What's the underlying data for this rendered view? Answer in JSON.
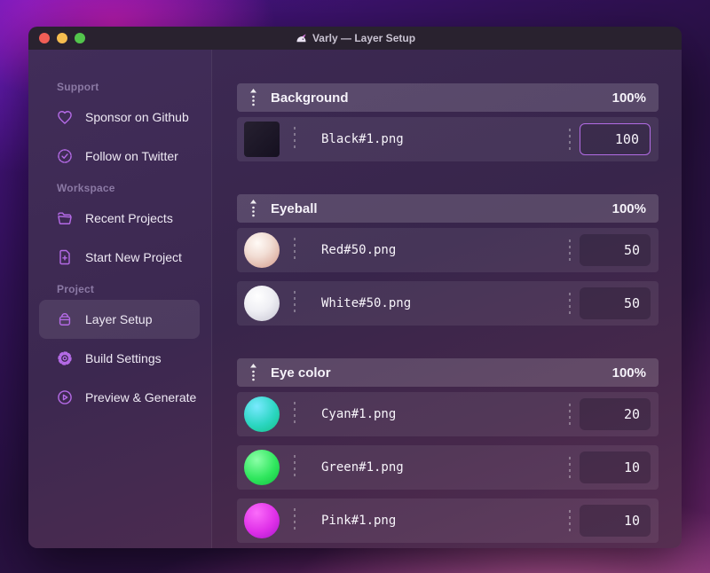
{
  "window": {
    "title": "Varly — Layer Setup",
    "app_icon": "unicorn",
    "traffic_lights": [
      "close",
      "minimize",
      "zoom"
    ]
  },
  "sidebar": {
    "sections": [
      {
        "label": "Support",
        "items": [
          {
            "label": "Sponsor on Github",
            "icon": "heart-icon"
          },
          {
            "label": "Follow on Twitter",
            "icon": "verified-check-icon"
          }
        ]
      },
      {
        "label": "Workspace",
        "items": [
          {
            "label": "Recent Projects",
            "icon": "folder-icon"
          },
          {
            "label": "Start New Project",
            "icon": "file-plus-icon"
          }
        ]
      },
      {
        "label": "Project",
        "items": [
          {
            "label": "Layer Setup",
            "icon": "layers-box-icon",
            "selected": true
          },
          {
            "label": "Build Settings",
            "icon": "gear-icon"
          },
          {
            "label": "Preview & Generate",
            "icon": "play-circle-icon"
          }
        ]
      }
    ]
  },
  "layers": {
    "groups": [
      {
        "name": "Background",
        "opacity": "100%",
        "items": [
          {
            "file": "Black#1.png",
            "weight": "100",
            "thumb": "black-square",
            "focused": true
          }
        ]
      },
      {
        "name": "Eyeball",
        "opacity": "100%",
        "items": [
          {
            "file": "Red#50.png",
            "weight": "50",
            "thumb": "red-sphere"
          },
          {
            "file": "White#50.png",
            "weight": "50",
            "thumb": "white-sphere"
          }
        ]
      },
      {
        "name": "Eye color",
        "opacity": "100%",
        "items": [
          {
            "file": "Cyan#1.png",
            "weight": "20",
            "thumb": "cyan-sphere"
          },
          {
            "file": "Green#1.png",
            "weight": "10",
            "thumb": "green-sphere"
          },
          {
            "file": "Pink#1.png",
            "weight": "10",
            "thumb": "pink-sphere"
          }
        ]
      }
    ]
  },
  "colors": {
    "accent_focus_border": "#b26ce4",
    "sidebar_icon": "#b46ae6",
    "titlebar_bg": "#29222f",
    "traffic_red": "#f15e56",
    "traffic_yellow": "#f5bd4f",
    "traffic_green": "#53c54c",
    "thumb_black": "#1a1422",
    "thumb_red": "#e0b5a8",
    "thumb_white": "#efeff4",
    "thumb_cyan": "#2cd6c2",
    "thumb_green": "#30e75e",
    "thumb_pink": "#df30e8"
  }
}
